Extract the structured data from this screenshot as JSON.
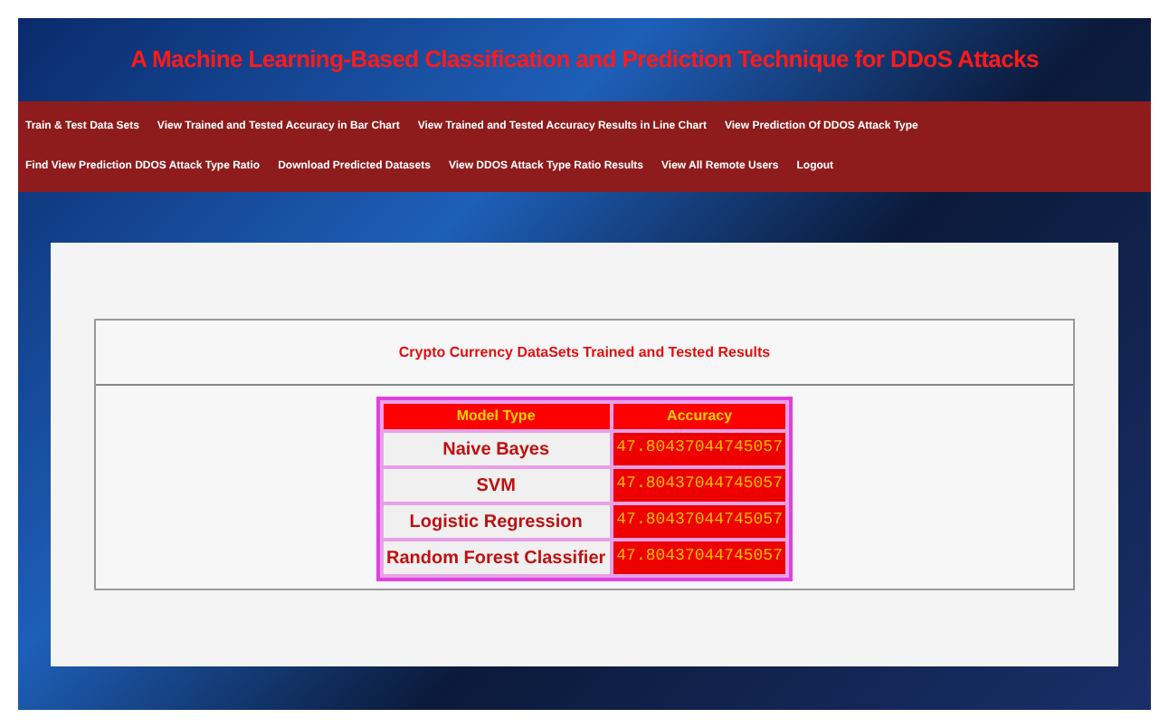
{
  "header": {
    "title": "A Machine Learning-Based Classification and Prediction Technique for DDoS Attacks"
  },
  "nav": {
    "items": [
      {
        "label": "Train & Test Data Sets"
      },
      {
        "label": "View Trained and Tested Accuracy in Bar Chart"
      },
      {
        "label": "View Trained and Tested Accuracy Results in Line Chart"
      },
      {
        "label": "View Prediction Of DDOS Attack Type"
      },
      {
        "label": "Find View Prediction DDOS Attack Type Ratio"
      },
      {
        "label": "Download Predicted Datasets"
      },
      {
        "label": "View DDOS Attack Type Ratio Results"
      },
      {
        "label": "View All Remote Users"
      },
      {
        "label": "Logout"
      }
    ]
  },
  "panel": {
    "heading": "Crypto Currency DataSets Trained and Tested Results",
    "table": {
      "columns": [
        "Model Type",
        "Accuracy"
      ],
      "rows": [
        [
          "Naive Bayes",
          "47.80437044745057"
        ],
        [
          "SVM",
          "47.80437044745057"
        ],
        [
          "Logistic Regression",
          "47.80437044745057"
        ],
        [
          "Random Forest Classifier",
          "47.80437044745057"
        ]
      ]
    }
  }
}
